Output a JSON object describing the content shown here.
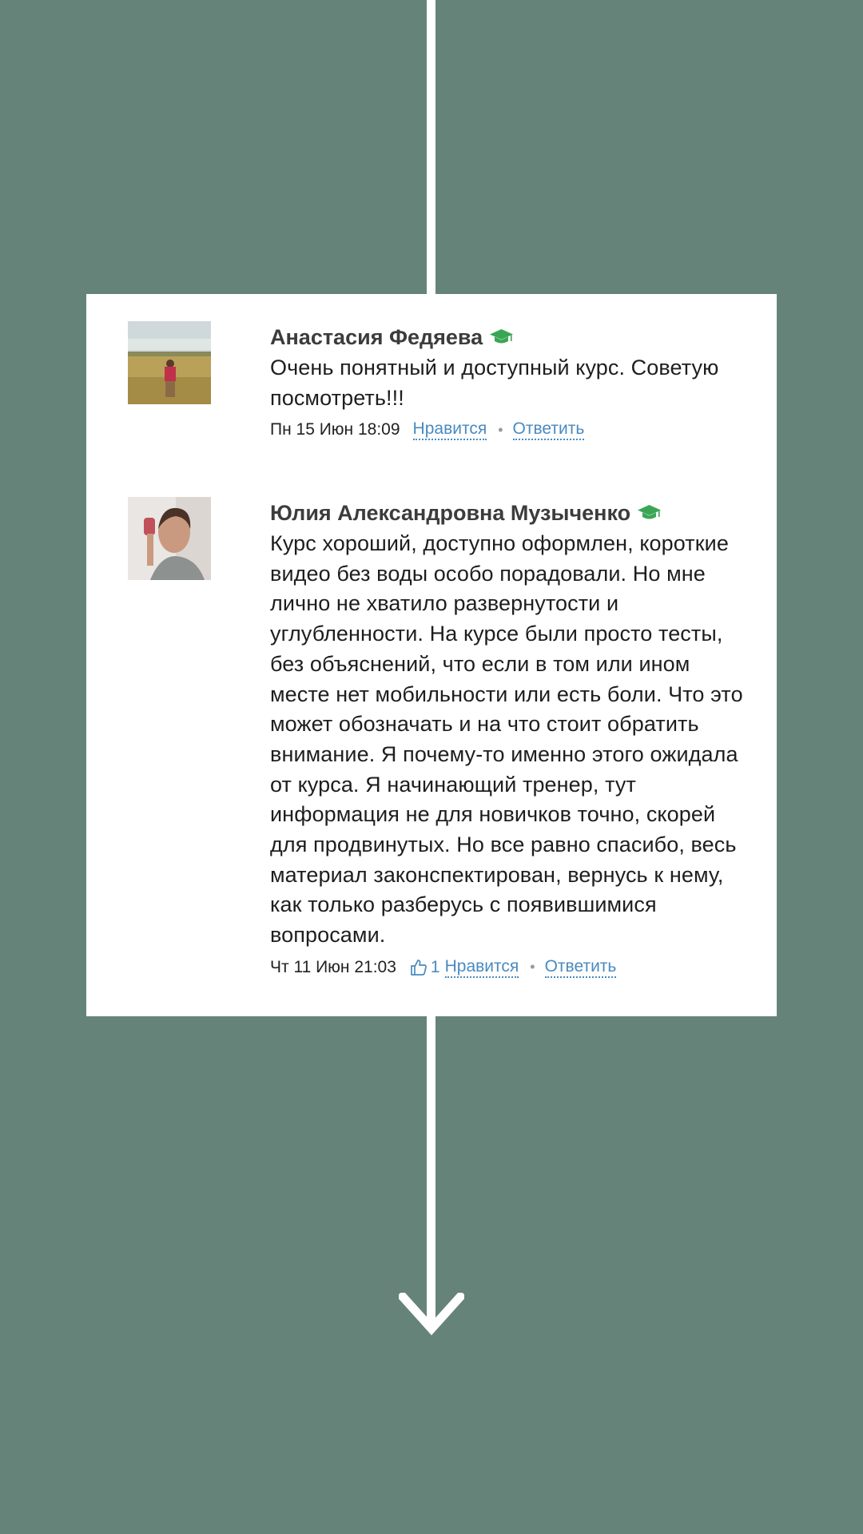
{
  "comments": [
    {
      "author": "Анастасия Федяева",
      "badge_icon": "graduation-cap-icon",
      "text_lines": [
        "Очень понятный и доступный курс. Советую",
        "посмотреть!!!"
      ],
      "date": "Пн 15 Июн 18:09",
      "like_label": "Нравится",
      "reply_label": "Ответить"
    },
    {
      "author": "Юлия Александровна Музыченко",
      "badge_icon": "graduation-cap-icon",
      "text_lines": [
        "Курс хороший, доступно оформлен, короткие",
        "видео без воды особо порадовали. Но мне",
        "лично не хватило развернутости и",
        "углубленности. На курсе были просто тесты,",
        "без объяснений, что если в том или ином",
        "месте нет мобильности или есть боли. Что это",
        "может обозначать и на что стоит обратить",
        "внимание. Я почему-то именно этого ожидала",
        "от курса. Я начинающий тренер, тут",
        "информация не для новичков точно, скорей",
        "для продвинутых. Но все равно спасибо, весь",
        "материал законспектирован, вернусь к нему,",
        "как только разберусь с появившимися",
        "вопросами."
      ],
      "date": "Чт 11 Июн 21:03",
      "like_count": "1",
      "like_label": "Нравится",
      "reply_label": "Ответить"
    }
  ],
  "separator": "•",
  "colors": {
    "background": "#66837a",
    "card": "#ffffff",
    "link": "#4a8ac0",
    "badge": "#3aa655"
  }
}
